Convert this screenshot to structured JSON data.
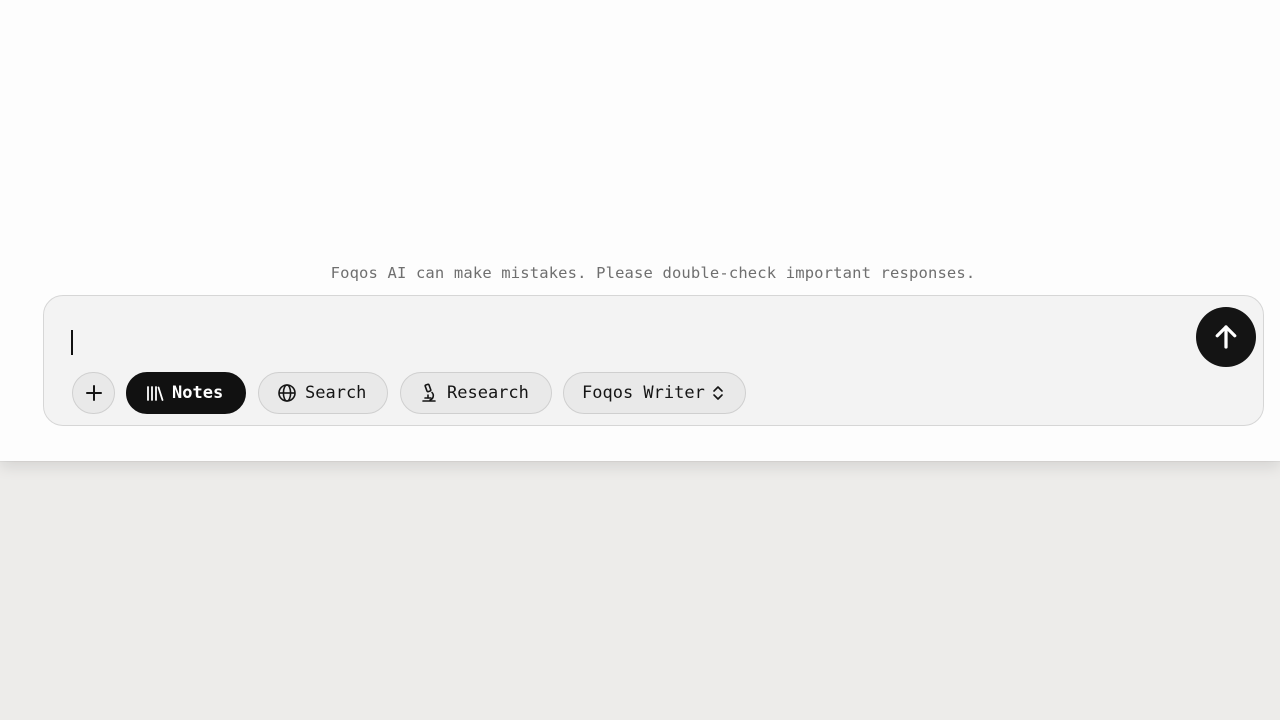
{
  "disclaimer": "Foqos AI can make mistakes. Please double-check important responses.",
  "composer": {
    "input_value": "",
    "send_icon": "arrow-up-icon"
  },
  "toolbar": {
    "add_icon": "plus-icon",
    "notes": {
      "label": "Notes",
      "icon": "library-icon",
      "active": true
    },
    "search": {
      "label": "Search",
      "icon": "globe-icon",
      "active": false
    },
    "research": {
      "label": "Research",
      "icon": "microscope-icon",
      "active": false
    },
    "model": {
      "label": "Foqos Writer",
      "icon": "chevron-up-down-icon"
    }
  },
  "colors": {
    "page_background": "#fdfdfd",
    "outer_background": "#edecea",
    "composer_background": "#f3f3f3",
    "active_chip": "#111111",
    "send_button": "#141414"
  }
}
